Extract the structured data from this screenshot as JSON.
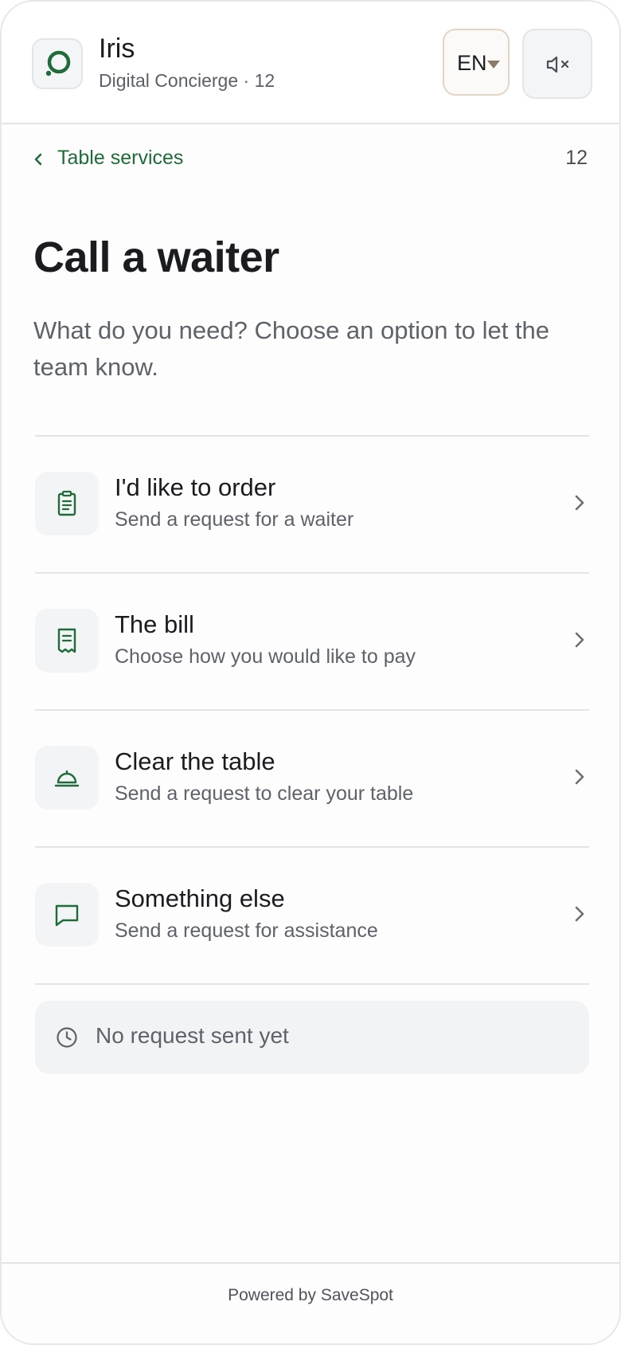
{
  "header": {
    "app_name": "Iris",
    "subtitle": "Digital Concierge · 12",
    "language": "EN",
    "logo_icon": "ring-logo-icon",
    "mute_icon": "speaker-muted-icon"
  },
  "breadcrumb": {
    "back_label": "Table services",
    "table_number": "12"
  },
  "page": {
    "title": "Call a waiter",
    "description": "What do you need? Choose an option to let the team know."
  },
  "options": [
    {
      "title": "I'd like to order",
      "subtitle": "Send a request for a waiter",
      "icon": "clipboard-list-icon"
    },
    {
      "title": "The bill",
      "subtitle": "Choose how you would like to pay",
      "icon": "receipt-icon"
    },
    {
      "title": "Clear the table",
      "subtitle": "Send a request to clear your table",
      "icon": "cloche-icon"
    },
    {
      "title": "Something else",
      "subtitle": "Send a request for assistance",
      "icon": "chat-bubble-icon"
    }
  ],
  "status": {
    "text": "No request sent yet",
    "icon": "clock-icon"
  },
  "footer": {
    "text": "Powered by SaveSpot"
  },
  "colors": {
    "accent": "#1f6b3a",
    "muted_text": "#5e6269",
    "surface": "#f3f4f6",
    "language_border": "#e2d5c5"
  }
}
